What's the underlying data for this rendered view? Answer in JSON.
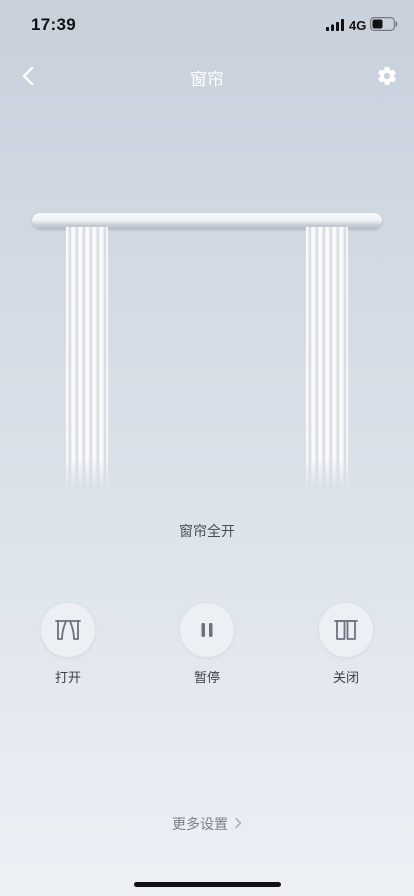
{
  "status_bar": {
    "time": "17:39",
    "network": "4G",
    "icons": [
      "signal-icon",
      "battery-icon"
    ]
  },
  "nav": {
    "title": "窗帘",
    "back_icon": "chevron-left-icon",
    "settings_icon": "gear-icon"
  },
  "curtain": {
    "status": "窗帘全开"
  },
  "controls": [
    {
      "label": "打开",
      "icon": "curtain-open-icon"
    },
    {
      "label": "暂停",
      "icon": "pause-icon"
    },
    {
      "label": "关闭",
      "icon": "curtain-close-icon"
    }
  ],
  "more_settings": {
    "label": "更多设置",
    "icon": "chevron-right-icon"
  },
  "colors": {
    "icon_gray": "#6b7280",
    "control_bg": "#eceff3"
  }
}
